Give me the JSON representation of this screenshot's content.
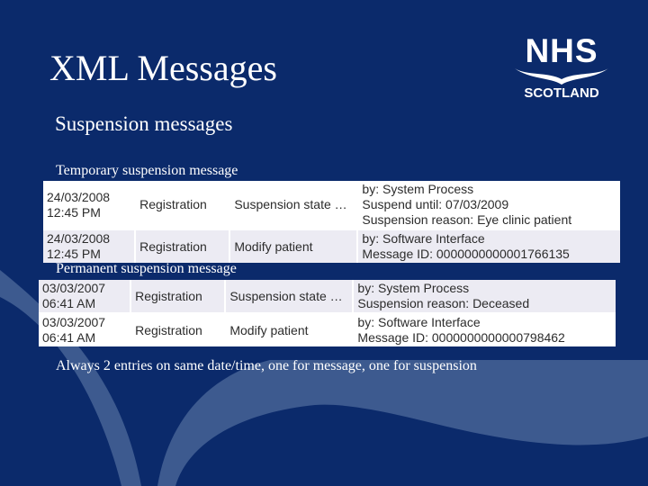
{
  "slide": {
    "title": "XML Messages",
    "subtitle": "Suspension messages",
    "footnote": "Always 2 entries on same date/time, one for message, one for suspension"
  },
  "logo": {
    "line1": "NHS",
    "line2": "SCOTLAND"
  },
  "colors": {
    "background": "#0b2a6b",
    "swoosh": "#3d5a8f",
    "row_grey": "#ecebf3",
    "row_white": "#ffffff"
  },
  "temporary": {
    "label": "Temporary suspension message",
    "rows": [
      {
        "date": "24/03/2008",
        "time": "12:45 PM",
        "type": "Registration",
        "event": "Suspension state …",
        "details": [
          "by: System Process",
          "Suspend until: 07/03/2009",
          "Suspension reason: Eye clinic patient"
        ]
      },
      {
        "date": "24/03/2008",
        "time": "12:45 PM",
        "type": "Registration",
        "event": "Modify patient",
        "details": [
          "by: Software Interface",
          "Message ID: 0000000000001766135"
        ]
      }
    ]
  },
  "permanent": {
    "label": "Permanent suspension message",
    "rows": [
      {
        "date": "03/03/2007",
        "time": "06:41 AM",
        "type": "Registration",
        "event": "Suspension state …",
        "details": [
          "by: System Process",
          "Suspension reason: Deceased"
        ]
      },
      {
        "date": "03/03/2007",
        "time": "06:41 AM",
        "type": "Registration",
        "event": "Modify patient",
        "details": [
          "by: Software Interface",
          "Message ID: 0000000000000798462"
        ]
      }
    ]
  }
}
